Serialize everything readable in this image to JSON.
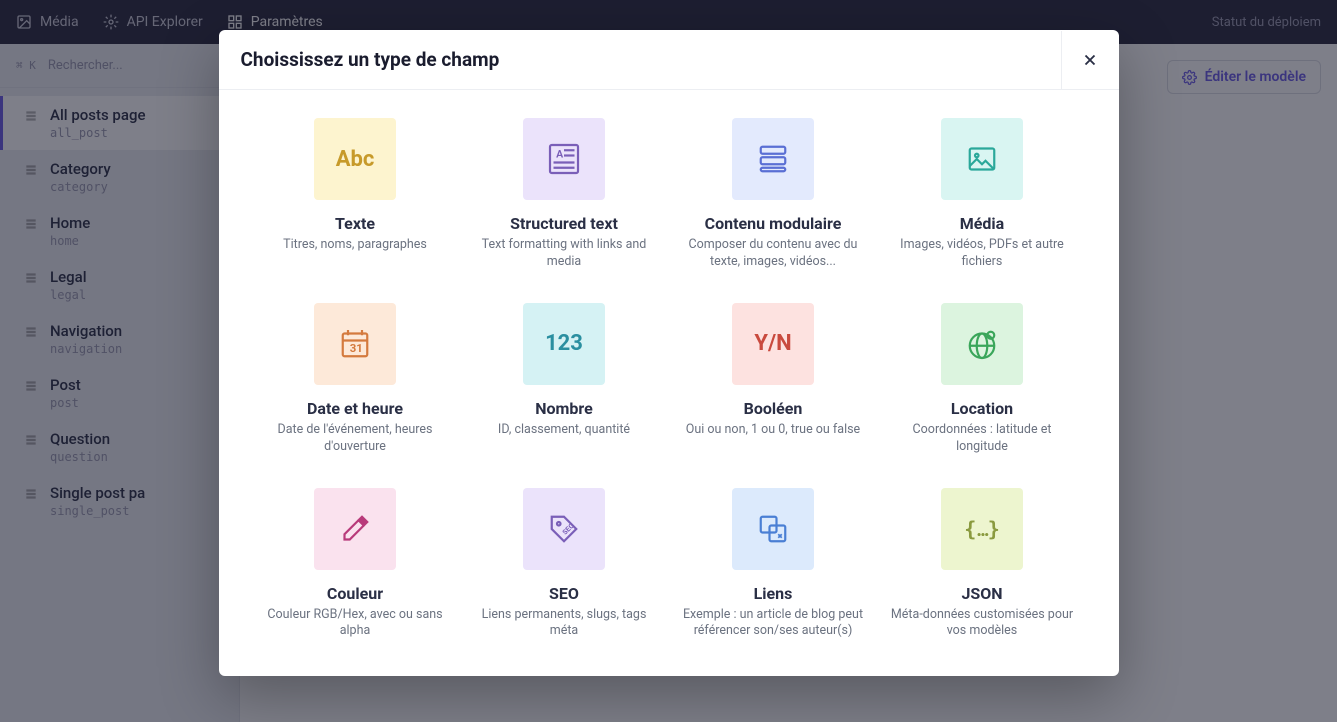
{
  "topbar": {
    "items": [
      {
        "label": "Média"
      },
      {
        "label": "API Explorer"
      },
      {
        "label": "Paramètres"
      }
    ],
    "status": "Statut du déploiem"
  },
  "sidebar": {
    "search_badge": "⌘ K",
    "search_placeholder": "Rechercher...",
    "items": [
      {
        "title": "All posts page",
        "slug": "all_post"
      },
      {
        "title": "Category",
        "slug": "category"
      },
      {
        "title": "Home",
        "slug": "home"
      },
      {
        "title": "Legal",
        "slug": "legal"
      },
      {
        "title": "Navigation",
        "slug": "navigation"
      },
      {
        "title": "Post",
        "slug": "post"
      },
      {
        "title": "Question",
        "slug": "question"
      },
      {
        "title": "Single post pa",
        "slug": "single_post"
      }
    ]
  },
  "content": {
    "edit_model": "Éditer le modèle"
  },
  "modal": {
    "title": "Choississez un type de champ",
    "fields": [
      {
        "name": "Texte",
        "desc": "Titres, noms, paragraphes"
      },
      {
        "name": "Structured text",
        "desc": "Text formatting with links and media"
      },
      {
        "name": "Contenu modulaire",
        "desc": "Composer du contenu avec du texte, images, vidéos..."
      },
      {
        "name": "Média",
        "desc": "Images, vidéos, PDFs et autre fichiers"
      },
      {
        "name": "Date et heure",
        "desc": "Date de l'événement, heures d'ouverture"
      },
      {
        "name": "Nombre",
        "desc": "ID, classement, quantité"
      },
      {
        "name": "Booléen",
        "desc": "Oui ou non, 1 ou 0, true ou false"
      },
      {
        "name": "Location",
        "desc": "Coordonnées : latitude et longitude"
      },
      {
        "name": "Couleur",
        "desc": "Couleur RGB/Hex, avec ou sans alpha"
      },
      {
        "name": "SEO",
        "desc": "Liens permanents, slugs, tags méta"
      },
      {
        "name": "Liens",
        "desc": "Exemple : un article de blog peut référencer son/ses auteur(s)"
      },
      {
        "name": "JSON",
        "desc": "Méta-données customisées pour vos modèles"
      }
    ]
  }
}
